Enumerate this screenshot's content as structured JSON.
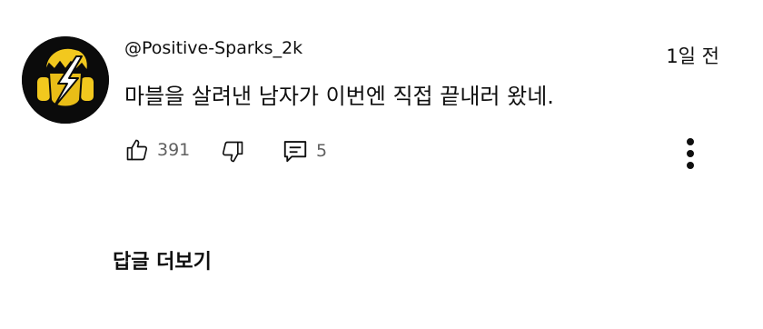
{
  "comment": {
    "author": "@Positive-Sparks_2k",
    "timestamp": "1일 전",
    "text": "마블을 살려낸 남자가 이번엔 직접 끝내러 왔네.",
    "like_count": "391",
    "reply_count": "5"
  },
  "replies_toggle": {
    "label": "답글 더보기"
  },
  "icons": {
    "like": "thumbs-up-icon",
    "dislike": "thumbs-down-icon",
    "reply": "comment-icon",
    "more": "more-vertical-icon"
  },
  "colors": {
    "text_primary": "#0f0f0f",
    "text_secondary": "#606060",
    "avatar_bg": "#0b0b0b",
    "avatar_accent": "#f2c81e"
  }
}
